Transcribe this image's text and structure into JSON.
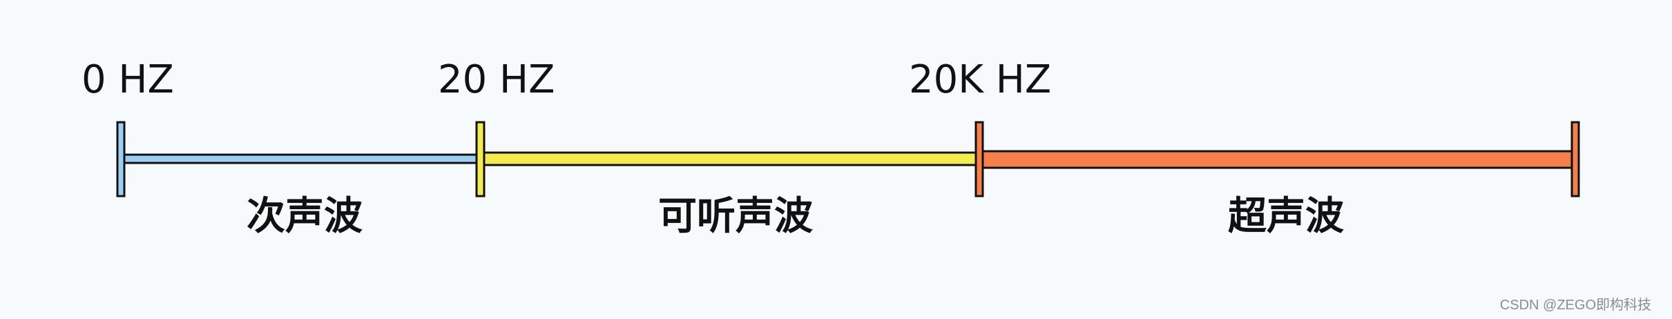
{
  "markers": {
    "start": "0 HZ",
    "infra_limit": "20 HZ",
    "ultra_limit": "20K HZ"
  },
  "bands": {
    "infrasound": {
      "label": "次声波",
      "color": "#9ccdf2"
    },
    "audible": {
      "label": "可听声波",
      "color": "#f3ec4c"
    },
    "ultrasound": {
      "label": "超声波",
      "color": "#f5804a"
    }
  },
  "watermark": "CSDN @ZEGO即构科技"
}
